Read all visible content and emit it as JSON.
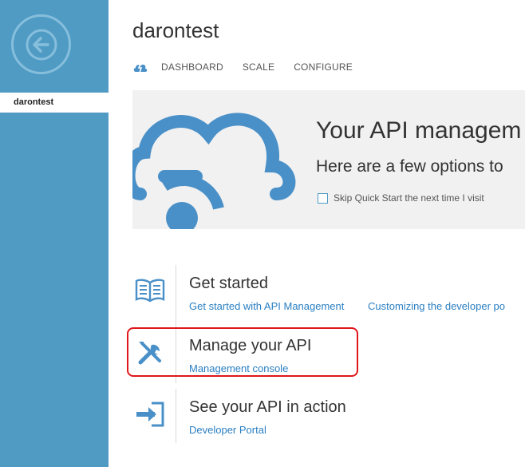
{
  "sidebar": {
    "back_icon": "arrow-left-icon",
    "items": [
      {
        "label": "darontest"
      }
    ]
  },
  "header": {
    "title": "darontest",
    "nav_icon": "quickstart-cloud-icon",
    "tabs": [
      {
        "label": "DASHBOARD"
      },
      {
        "label": "SCALE"
      },
      {
        "label": "CONFIGURE"
      }
    ]
  },
  "banner": {
    "heading": "Your API managem",
    "subheading": "Here are a few options to",
    "skip_label": "Skip Quick Start the next time I visit",
    "skip_checked": false,
    "icon": "cloud-icon"
  },
  "options": [
    {
      "title": "Get started",
      "icon": "book-icon",
      "links": [
        "Get started with API Management",
        "Customizing the developer po"
      ]
    },
    {
      "title": "Manage your API",
      "icon": "tools-icon",
      "links": [
        "Management console"
      ]
    },
    {
      "title": "See your API in action",
      "icon": "sign-in-icon",
      "links": [
        "Developer Portal"
      ]
    }
  ],
  "colors": {
    "sidebar": "#4f9bc4",
    "accent": "#4a90c8",
    "link": "#2a7fc2",
    "highlight": "#e0171b",
    "banner_bg": "#f1f1f1"
  }
}
